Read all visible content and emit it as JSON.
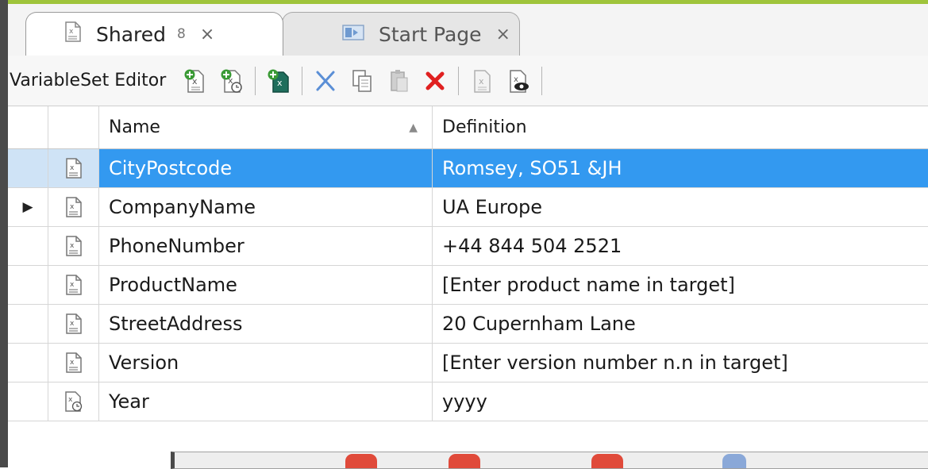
{
  "tabs": [
    {
      "label": "Shared",
      "pin": "8",
      "close": "×",
      "icon": "variable-set-icon",
      "active": true
    },
    {
      "label": "Start Page",
      "close": "×",
      "icon": "start-page-icon",
      "active": false
    }
  ],
  "toolbar": {
    "title": "VariableSet Editor",
    "buttons": [
      "add-variable-icon",
      "add-datetime-variable-icon",
      "add-from-file-icon",
      "cut-icon",
      "copy-icon",
      "paste-icon",
      "delete-icon",
      "edit-icon",
      "preview-icon"
    ]
  },
  "grid": {
    "columns": {
      "name": "Name",
      "definition": "Definition",
      "sort_indicator": "▲"
    },
    "current_row_marker": "▶",
    "rows": [
      {
        "name": "CityPostcode",
        "definition": "Romsey, SO51 &JH",
        "selected": true
      },
      {
        "name": "CompanyName",
        "definition": "UA Europe",
        "current": true
      },
      {
        "name": "PhoneNumber",
        "definition": "+44 844 504 2521"
      },
      {
        "name": "ProductName",
        "definition": "[Enter product name in target]"
      },
      {
        "name": "StreetAddress",
        "definition": "20 Cupernham Lane"
      },
      {
        "name": "Version",
        "definition": "[Enter version number  n.n in target]"
      },
      {
        "name": "Year",
        "definition": "yyyy",
        "icon": "datetime-variable-icon"
      }
    ]
  },
  "colors": {
    "accent": "#9fc43b",
    "selection": "#3399f0",
    "delete": "#e02020"
  }
}
